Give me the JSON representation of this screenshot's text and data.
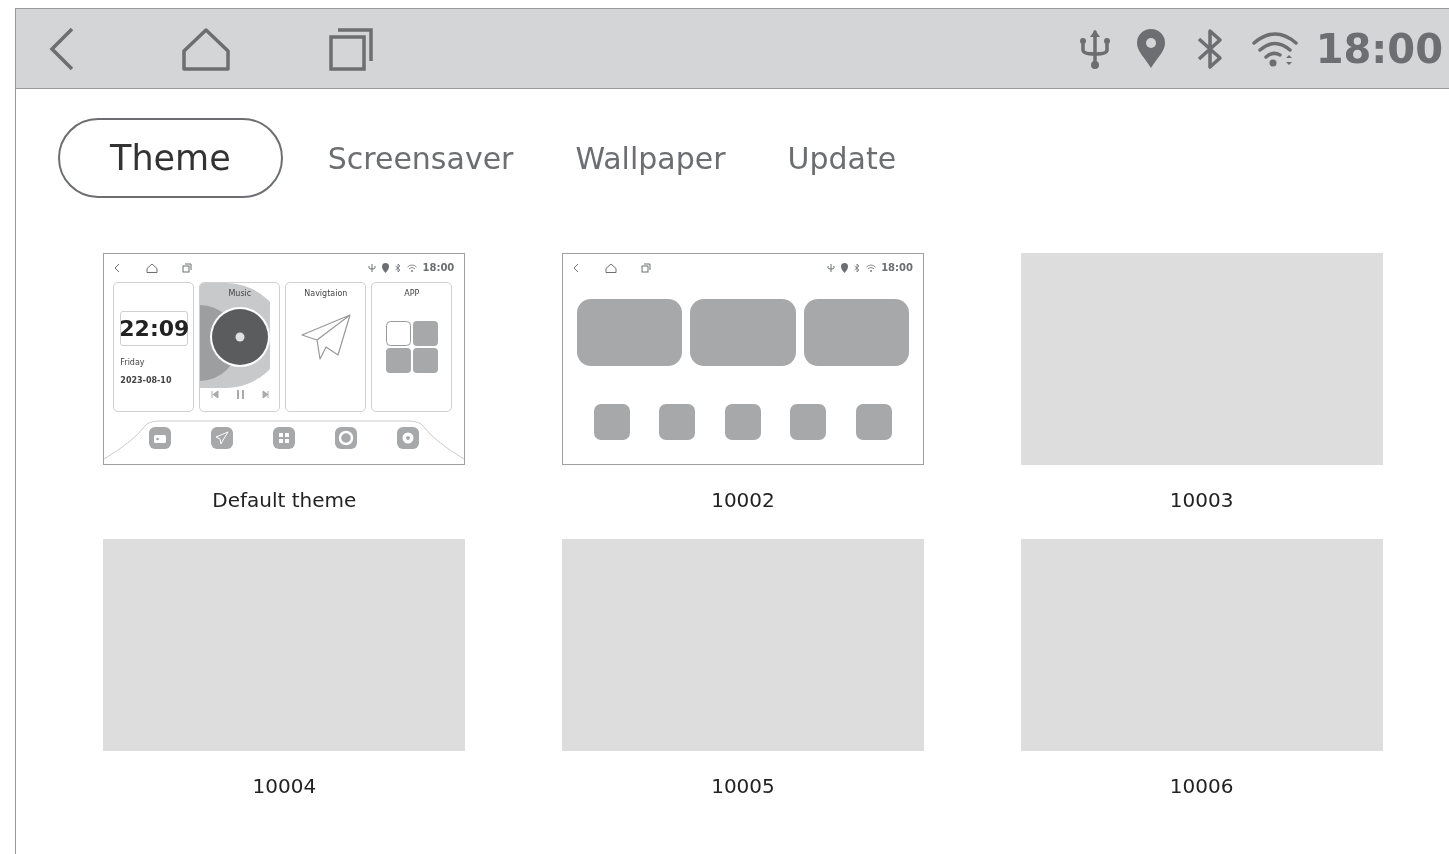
{
  "status_bar": {
    "time": "18:00"
  },
  "tabs": [
    {
      "label": "Theme",
      "selected": true
    },
    {
      "label": "Screensaver",
      "selected": false
    },
    {
      "label": "Wallpaper",
      "selected": false
    },
    {
      "label": "Update",
      "selected": false
    }
  ],
  "themes": [
    {
      "kind": "default",
      "name": "Default theme",
      "preview": {
        "time": "18:00",
        "clock": "22:09",
        "day": "Friday",
        "date": "2023-08-10",
        "cards": [
          "Music",
          "Navigtaion",
          "APP"
        ]
      }
    },
    {
      "kind": "grid",
      "name": "10002",
      "preview": {
        "time": "18:00"
      }
    },
    {
      "kind": "blank",
      "name": "10003"
    },
    {
      "kind": "blank",
      "name": "10004"
    },
    {
      "kind": "blank",
      "name": "10005"
    },
    {
      "kind": "blank",
      "name": "10006"
    }
  ]
}
